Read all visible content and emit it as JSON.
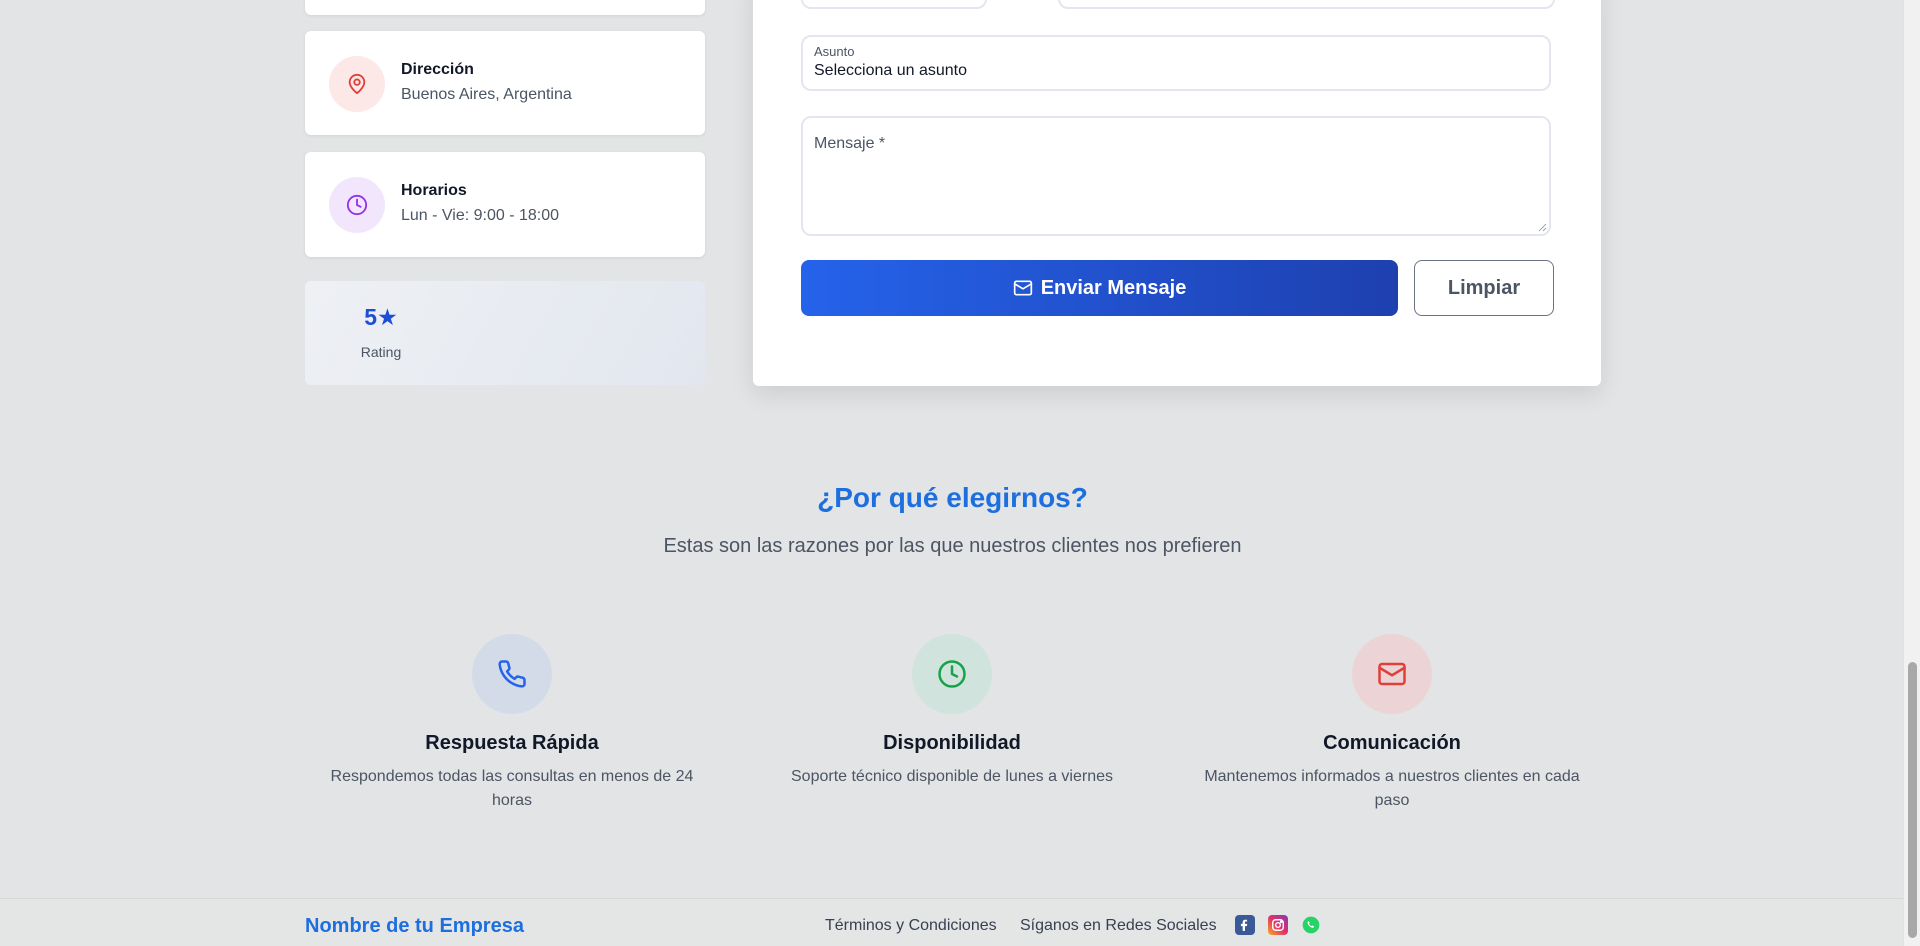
{
  "contact_info": {
    "address": {
      "title": "Dirección",
      "value": "Buenos Aires, Argentina",
      "icon": "map-pin-icon"
    },
    "hours": {
      "title": "Horarios",
      "value": "Lun - Vie: 9:00 - 18:00",
      "icon": "clock-icon"
    },
    "rating": {
      "value": "5★",
      "label": "Rating"
    }
  },
  "form": {
    "subject": {
      "label": "Asunto",
      "value": "Selecciona un asunto"
    },
    "message": {
      "placeholder": "Mensaje *"
    },
    "send_label": "Enviar Mensaje",
    "clear_label": "Limpiar"
  },
  "why": {
    "title": "¿Por qué elegirnos?",
    "subtitle": "Estas son las razones por las que nuestros clientes nos prefieren",
    "features": [
      {
        "icon": "phone-icon",
        "title": "Respuesta Rápida",
        "desc": "Respondemos todas las consultas en menos de 24 horas"
      },
      {
        "icon": "clock-icon",
        "title": "Disponibilidad",
        "desc": "Soporte técnico disponible de lunes a viernes"
      },
      {
        "icon": "mail-icon",
        "title": "Comunicación",
        "desc": "Mantenemos informados a nuestros clientes en cada paso"
      }
    ]
  },
  "footer": {
    "brand": "Nombre de tu Empresa",
    "terms": "Términos y Condiciones",
    "social": "Síganos en Redes Sociales"
  },
  "colors": {
    "accent": "#1d6fe0",
    "button": "#2563eb",
    "background": "#e3e4e5"
  }
}
